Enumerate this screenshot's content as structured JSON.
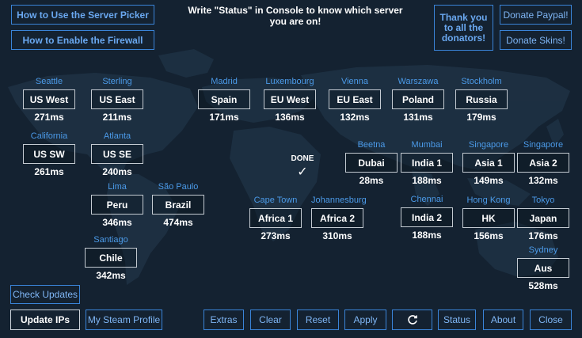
{
  "header": {
    "how_to_use": "How to Use the Server Picker",
    "how_to_firewall": "How to Enable the Firewall",
    "title": "Write \"Status\" in Console to know which server you are on!",
    "thanks": "Thank you to all the donators!",
    "donate_paypal": "Donate Paypal!",
    "donate_skins": "Donate Skins!"
  },
  "status": {
    "done": "DONE",
    "check": "✓"
  },
  "servers": [
    {
      "city": "Seattle",
      "name": "US West",
      "ping": "271ms"
    },
    {
      "city": "Sterling",
      "name": "US East",
      "ping": "211ms"
    },
    {
      "city": "Madrid",
      "name": "Spain",
      "ping": "171ms"
    },
    {
      "city": "Luxembourg",
      "name": "EU West",
      "ping": "136ms"
    },
    {
      "city": "Vienna",
      "name": "EU East",
      "ping": "132ms"
    },
    {
      "city": "Warszawa",
      "name": "Poland",
      "ping": "131ms"
    },
    {
      "city": "Stockholm",
      "name": "Russia",
      "ping": "179ms"
    },
    {
      "city": "California",
      "name": "US SW",
      "ping": "261ms"
    },
    {
      "city": "Atlanta",
      "name": "US SE",
      "ping": "240ms"
    },
    {
      "city": "Beetna",
      "name": "Dubai",
      "ping": "28ms"
    },
    {
      "city": "Mumbai",
      "name": "India 1",
      "ping": "188ms"
    },
    {
      "city": "Singapore",
      "name": "Asia 1",
      "ping": "149ms"
    },
    {
      "city": "Singapore",
      "name": "Asia 2",
      "ping": "132ms"
    },
    {
      "city": "Lima",
      "name": "Peru",
      "ping": "346ms"
    },
    {
      "city": "São Paulo",
      "name": "Brazil",
      "ping": "474ms"
    },
    {
      "city": "Cape Town",
      "name": "Africa 1",
      "ping": "273ms"
    },
    {
      "city": "Johannesburg",
      "name": "Africa 2",
      "ping": "310ms"
    },
    {
      "city": "Chennai",
      "name": "India 2",
      "ping": "188ms"
    },
    {
      "city": "Hong Kong",
      "name": "HK",
      "ping": "156ms"
    },
    {
      "city": "Tokyo",
      "name": "Japan",
      "ping": "176ms"
    },
    {
      "city": "Santiago",
      "name": "Chile",
      "ping": "342ms"
    },
    {
      "city": "Sydney",
      "name": "Aus",
      "ping": "528ms"
    }
  ],
  "footer": {
    "check_updates": "Check Updates",
    "update_ips": "Update IPs",
    "steam_profile": "My Steam Profile",
    "extras": "Extras",
    "clear": "Clear",
    "reset": "Reset",
    "apply": "Apply",
    "refresh_icon": "refresh-icon",
    "status": "Status",
    "about": "About",
    "close": "Close"
  },
  "colors": {
    "background": "#142231",
    "accent": "#3a84d8",
    "city_label": "#4b9ae8",
    "map_land": "#1f3243"
  }
}
